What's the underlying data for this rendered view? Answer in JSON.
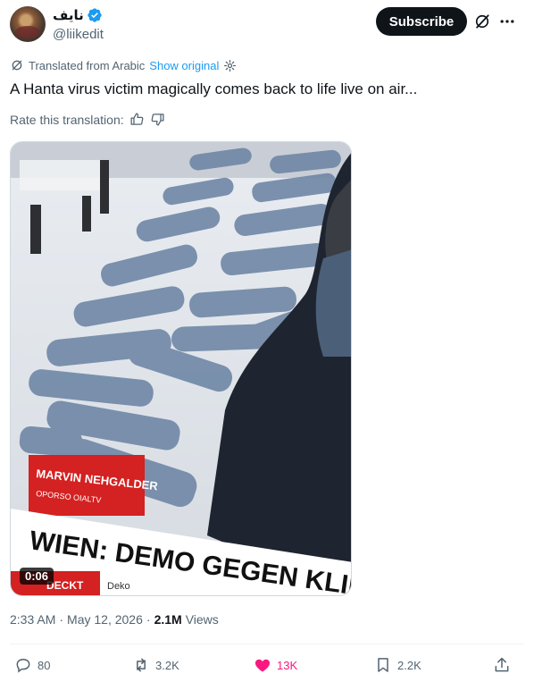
{
  "author": {
    "display_name": "نايف",
    "handle": "@liikedit",
    "verified": true,
    "avatar_icon": "avatar-image"
  },
  "header": {
    "subscribe_label": "Subscribe",
    "grok_icon": "grok-icon",
    "more_icon": "more-dots-icon"
  },
  "translation": {
    "note": "Translated from Arabic",
    "show_original": "Show original",
    "rate_label": "Rate this translation:"
  },
  "post": {
    "text": "A Hanta virus victim magically comes back to life live on air..."
  },
  "video": {
    "duration": "0:06",
    "ticker_headline": "WIEN: DEMO GEGEN KLIMA",
    "name_badge": "MARVIN NEHGALDER",
    "name_sub": "OPORSO OIALTV",
    "ticker_tag": "DECKT",
    "ticker_extra": "Deko"
  },
  "meta": {
    "time": "2:33 AM",
    "sep1": "·",
    "date": "May 12, 2026",
    "sep2": "·",
    "views_count": "2.1M",
    "views_label": "Views"
  },
  "actions": {
    "replies": "80",
    "reposts": "3.2K",
    "likes": "13K",
    "bookmarks": "2.2K"
  },
  "colors": {
    "accent": "#1d9bf0",
    "like": "#f91880",
    "subscribe_bg": "#0f1419",
    "muted": "#536471"
  }
}
